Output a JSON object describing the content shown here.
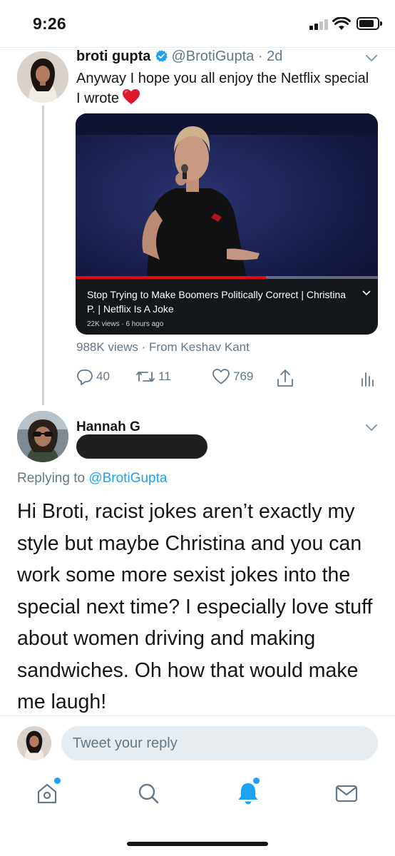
{
  "status_bar": {
    "time": "9:26"
  },
  "tweet": {
    "author_name": "broti gupta",
    "author_handle": "@BrotiGupta",
    "separator": "·",
    "timestamp": "2d",
    "text": "Anyway I hope you all enjoy the Netflix special I wrote",
    "emoji": "heart-emoji",
    "video": {
      "title": "Stop Trying to Make Boomers Politically Correct | Christina P. | Netflix Is A Joke",
      "meta": "22K views · 6 hours ago",
      "progress": 0.63
    },
    "view_stats": "988K views · From Keshav Kant",
    "replies": "40",
    "retweets": "11",
    "likes": "769"
  },
  "reply": {
    "author_name": "Hannah G",
    "replying_label": "Replying to",
    "replying_handle": "@BrotiGupta",
    "text": "Hi Broti, racist jokes aren’t exactly my style but maybe Christina and you can work some more sexist jokes into the special next time? I especially love stuff about women driving and making sandwiches. Oh how that would make me laugh!"
  },
  "composer": {
    "placeholder": "Tweet your reply"
  },
  "tab_bar": {
    "items": [
      "home-icon",
      "search-icon",
      "notifications-icon",
      "messages-icon"
    ],
    "accent": "#1da1f2"
  },
  "colors": {
    "accent": "#1da1f2",
    "muted": "#657786",
    "text": "#14171a"
  }
}
